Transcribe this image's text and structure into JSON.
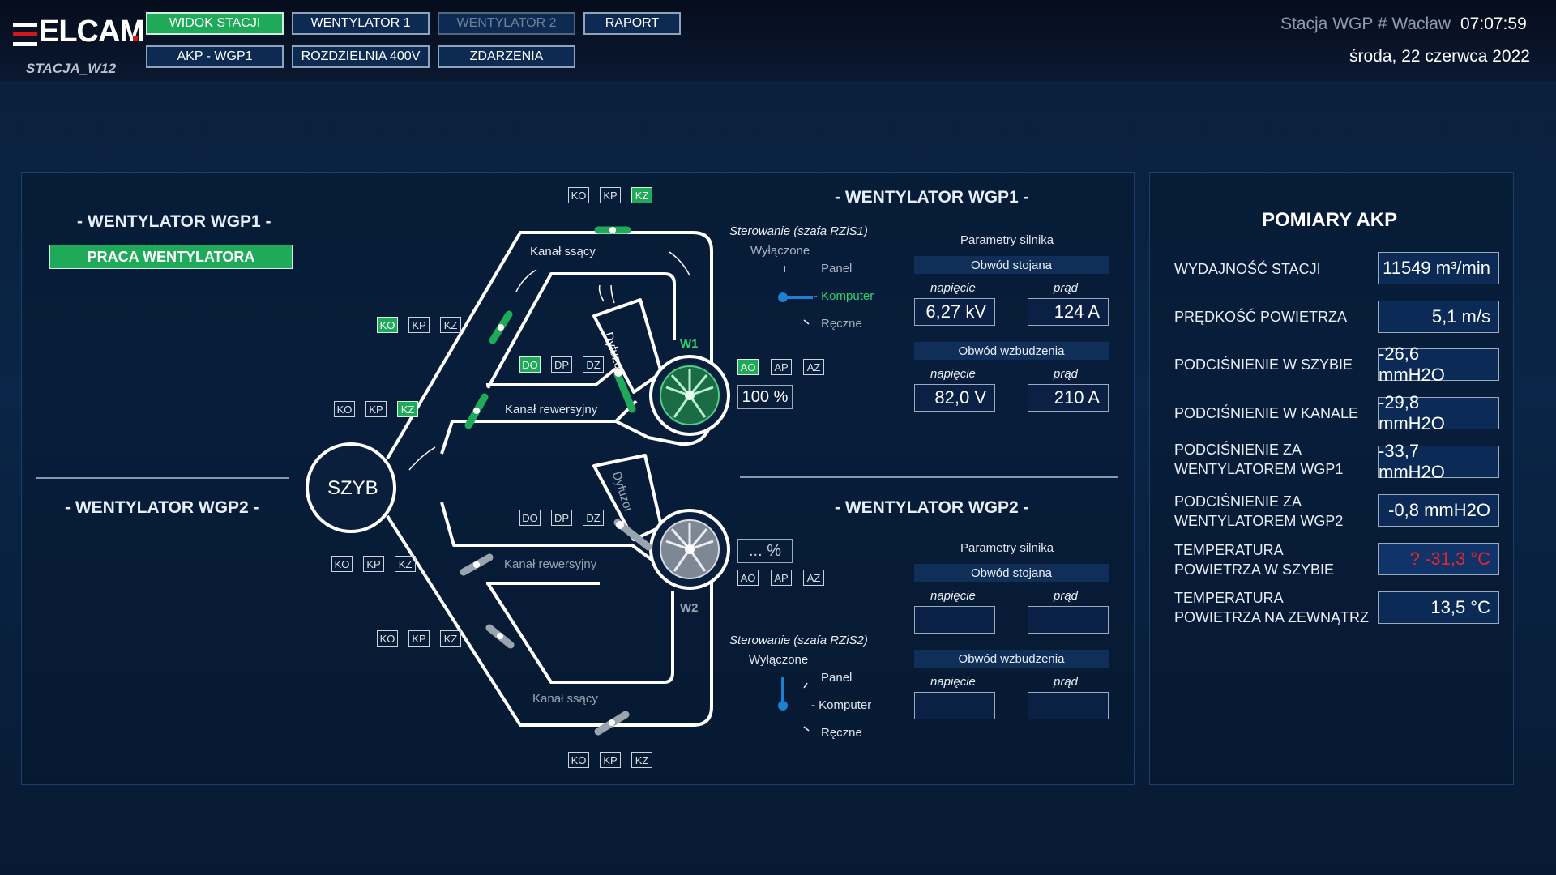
{
  "header": {
    "logo": "ELCAM",
    "station_tag": "STACJA_W12",
    "nav": [
      "WIDOK STACJI",
      "WENTYLATOR 1",
      "WENTYLATOR 2",
      "RAPORT",
      "AKP - WGP1",
      "ROZDZIELNIA 400V",
      "ZDARZENIA"
    ],
    "station_name": "Stacja WGP # Wacław",
    "time": "07:07:59",
    "date": "środa, 22 czerwca 2022"
  },
  "colors": {
    "active": "#1faa5a",
    "alarm": "#e02828",
    "panel_dark": "#0f2f58"
  },
  "left": {
    "wgp1_title": "- WENTYLATOR WGP1 -",
    "wgp1_status": "PRACA WENTYLATORA",
    "wgp2_title": "- WENTYLATOR WGP2 -"
  },
  "diagram": {
    "shaft": "SZYB",
    "kanal_ssacy_top": "Kanał ssący",
    "kanal_ssacy_bottom": "Kanał ssący",
    "kanal_rew_top": "Kanał rewersyjny",
    "kanal_rew_bottom": "Kanał rewersyjny",
    "dyfuzor1": "Dyfuzor",
    "dyfuzor2": "Dyfuzor",
    "w1": "W1",
    "w2": "W2",
    "k_labels": [
      "KO",
      "KP",
      "KZ"
    ],
    "d_labels": [
      "DO",
      "DP",
      "DZ"
    ],
    "a_labels": [
      "AO",
      "AP",
      "AZ"
    ],
    "fan1_pct": "100 %",
    "fan2_pct": "... %"
  },
  "wgp1": {
    "title": "- WENTYLATOR WGP1 -",
    "sterowanie": "Sterowanie (szafa RZiS1)",
    "mode_off": "Wyłączone",
    "mode_panel": "Panel",
    "mode_komp": "- Komputer",
    "mode_reczne": "Ręczne",
    "params": "Parametry silnika",
    "stojana": "Obwód stojana",
    "wzbudzenia": "Obwód wzbudzenia",
    "napiecie": "napięcie",
    "prad": "prąd",
    "st_u": "6,27 kV",
    "st_i": "124 A",
    "wz_u": "82,0 V",
    "wz_i": "210 A"
  },
  "wgp2": {
    "title": "- WENTYLATOR WGP2 -",
    "sterowanie": "Sterowanie (szafa RZiS2)",
    "mode_off": "Wyłączone",
    "mode_panel": "Panel",
    "mode_komp": "- Komputer",
    "mode_reczne": "Ręczne",
    "params": "Parametry silnika",
    "stojana": "Obwód stojana",
    "wzbudzenia": "Obwód wzbudzenia",
    "napiecie": "napięcie",
    "prad": "prąd"
  },
  "akp": {
    "title": "POMIARY AKP",
    "rows": [
      {
        "l1": "WYDAJNOŚĆ STACJI",
        "l2": "",
        "value": "11549 m³/min"
      },
      {
        "l1": "PRĘDKOŚĆ POWIETRZA",
        "l2": "",
        "value": "5,1 m/s"
      },
      {
        "l1": "PODCIŚNIENIE W SZYBIE",
        "l2": "",
        "value": "-26,6 mmH2O"
      },
      {
        "l1": "PODCIŚNIENIE W KANALE",
        "l2": "",
        "value": "-29,8 mmH2O"
      },
      {
        "l1": "PODCIŚNIENIE ZA",
        "l2": "WENTYLATOREM WGP1",
        "value": "-33,7 mmH2O"
      },
      {
        "l1": "PODCIŚNIENIE ZA",
        "l2": "WENTYLATOREM WGP2",
        "value": "-0,8 mmH2O"
      },
      {
        "l1": "TEMPERATURA",
        "l2": "POWIETRZA W SZYBIE",
        "value": "? -31,3 °C"
      },
      {
        "l1": "TEMPERATURA",
        "l2": "POWIETRZA NA ZEWNĄTRZ",
        "value": "13,5 °C"
      }
    ]
  }
}
